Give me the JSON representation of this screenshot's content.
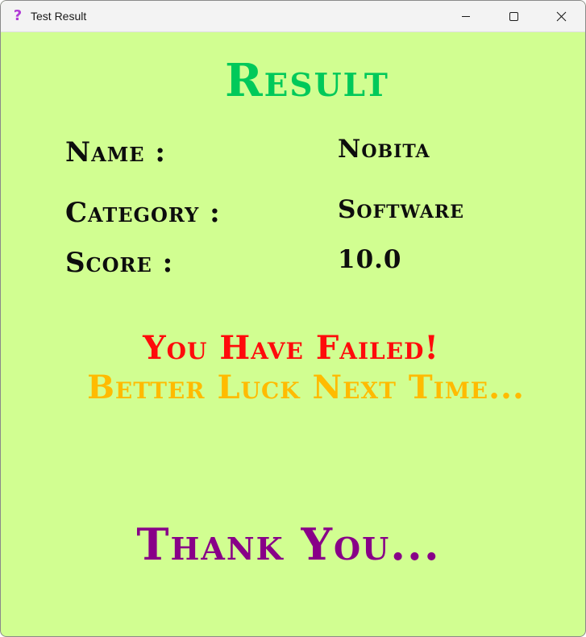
{
  "window": {
    "title": "Test Result",
    "icon": "question-mark-icon",
    "icon_glyph": "?",
    "controls": [
      "minimize-icon",
      "maximize-icon",
      "close-icon"
    ]
  },
  "colors": {
    "background": "#d1fe91",
    "heading": "#00c95a",
    "fail": "#ff0b0b",
    "luck": "#ffbb00",
    "thanks": "#880088",
    "text": "#0d0d0d",
    "icon": "#b13bd6"
  },
  "result": {
    "heading": "Result",
    "fields": {
      "name_label": "Name :",
      "name_value": "Nobita",
      "category_label": "Category :",
      "category_value": "Software",
      "score_label": "Score :",
      "score_value": "10.0"
    },
    "fail_message": "You Have Failed!",
    "luck_message": "Better Luck Next Time...",
    "thanks_message": "Thank You..."
  }
}
